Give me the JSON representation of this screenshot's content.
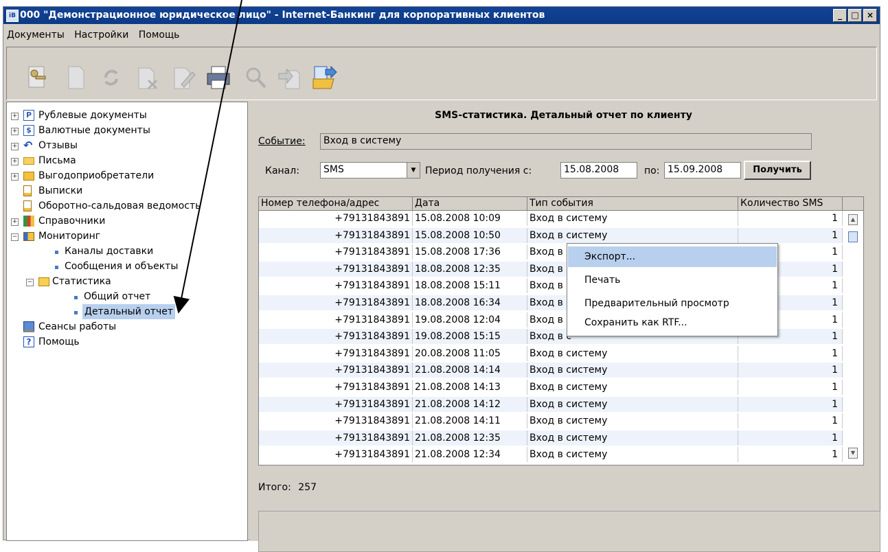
{
  "window": {
    "title": "000 \"Демонстрационное юридическое лицо\" - Internet-Банкинг для корпоративных клиентов",
    "app_icon_text": "iB",
    "minimize": "_",
    "maximize": "□",
    "close": "×"
  },
  "menu": [
    "Документы",
    "Настройки",
    "Помощь"
  ],
  "toolbar": {
    "icons": [
      "keys-icon",
      "document-icon",
      "refresh-icon",
      "delete-document-icon",
      "edit-document-icon",
      "print-icon",
      "search-icon",
      "import-icon",
      "export-folder-icon"
    ]
  },
  "tree": {
    "items": [
      {
        "label": "Рублевые документы",
        "icon": "ruble-icon",
        "expand": "+",
        "level": 0
      },
      {
        "label": "Валютные документы",
        "icon": "dollar-icon",
        "expand": "+",
        "level": 0
      },
      {
        "label": "Отзывы",
        "icon": "revoke-icon",
        "expand": "+",
        "level": 0
      },
      {
        "label": "Письма",
        "icon": "envelope-icon",
        "expand": "+",
        "level": 0
      },
      {
        "label": "Выгодоприобретатели",
        "icon": "folder-icon",
        "expand": "+",
        "level": 0
      },
      {
        "label": "Выписки",
        "icon": "statement-icon",
        "expand": "",
        "level": 0
      },
      {
        "label": "Оборотно-сальдовая ведомость",
        "icon": "statement-icon",
        "expand": "",
        "level": 0
      },
      {
        "label": "Справочники",
        "icon": "books-icon",
        "expand": "+",
        "level": 0
      },
      {
        "label": "Мониторинг",
        "icon": "monitor-folder-icon",
        "expand": "−",
        "level": 0
      },
      {
        "label": "Каналы доставки",
        "icon": "bullet",
        "expand": "",
        "level": 1
      },
      {
        "label": "Сообщения и объекты",
        "icon": "bullet",
        "expand": "",
        "level": 1
      },
      {
        "label": "Статистика",
        "icon": "open-folder-icon",
        "expand": "−",
        "level": 1
      },
      {
        "label": "Общий отчет",
        "icon": "bullet",
        "expand": "",
        "level": 2
      },
      {
        "label": "Детальный отчет",
        "icon": "bullet",
        "expand": "",
        "level": 2
      },
      {
        "label": "Сеансы работы",
        "icon": "computer-icon",
        "expand": "",
        "level": 0
      },
      {
        "label": "Помощь",
        "icon": "help-icon",
        "expand": "",
        "level": 0
      }
    ],
    "selected": "Детальный отчет"
  },
  "report": {
    "title": "SMS-статистика. Детальный отчет по клиенту",
    "event_label": "Событие:",
    "event_value": "Вход в систему",
    "channel_label": "Канал:",
    "channel_value": "SMS",
    "period_label": "Период получения с:",
    "date_from": "15.08.2008",
    "to_label": "по:",
    "date_to": "15.09.2008",
    "get_button": "Получить",
    "total_label": "Итого:",
    "total_value": "257"
  },
  "table": {
    "columns": [
      "Номер телефона/адрес",
      "Дата",
      "Тип события",
      "Количество SMS"
    ],
    "rows": [
      [
        "+79131843891",
        "15.08.2008 10:09",
        "Вход в систему",
        "1"
      ],
      [
        "+79131843891",
        "15.08.2008 10:50",
        "Вход в систему",
        "1"
      ],
      [
        "+79131843891",
        "15.08.2008 17:36",
        "Вход в с",
        "1"
      ],
      [
        "+79131843891",
        "18.08.2008 12:35",
        "Вход в с",
        "1"
      ],
      [
        "+79131843891",
        "18.08.2008 15:11",
        "Вход в с",
        "1"
      ],
      [
        "+79131843891",
        "18.08.2008 16:34",
        "Вход в с",
        "1"
      ],
      [
        "+79131843891",
        "19.08.2008 12:04",
        "Вход в с",
        "1"
      ],
      [
        "+79131843891",
        "19.08.2008 15:15",
        "Вход в с",
        "1"
      ],
      [
        "+79131843891",
        "20.08.2008 11:05",
        "Вход в систему",
        "1"
      ],
      [
        "+79131843891",
        "21.08.2008 14:14",
        "Вход в систему",
        "1"
      ],
      [
        "+79131843891",
        "21.08.2008 14:13",
        "Вход в систему",
        "1"
      ],
      [
        "+79131843891",
        "21.08.2008 14:12",
        "Вход в систему",
        "1"
      ],
      [
        "+79131843891",
        "21.08.2008 14:11",
        "Вход в систему",
        "1"
      ],
      [
        "+79131843891",
        "21.08.2008 12:35",
        "Вход в систему",
        "1"
      ],
      [
        "+79131843891",
        "21.08.2008 12:34",
        "Вход в систему",
        "1"
      ]
    ]
  },
  "context_menu": {
    "items": [
      "Экспорт...",
      "Печать",
      "Предварительный просмотр",
      "Сохранить как RTF..."
    ],
    "highlighted": "Экспорт..."
  },
  "colors": {
    "title_bar": "#124396",
    "selection": "#b8d0ee",
    "row_alt": "#eef3fb"
  }
}
